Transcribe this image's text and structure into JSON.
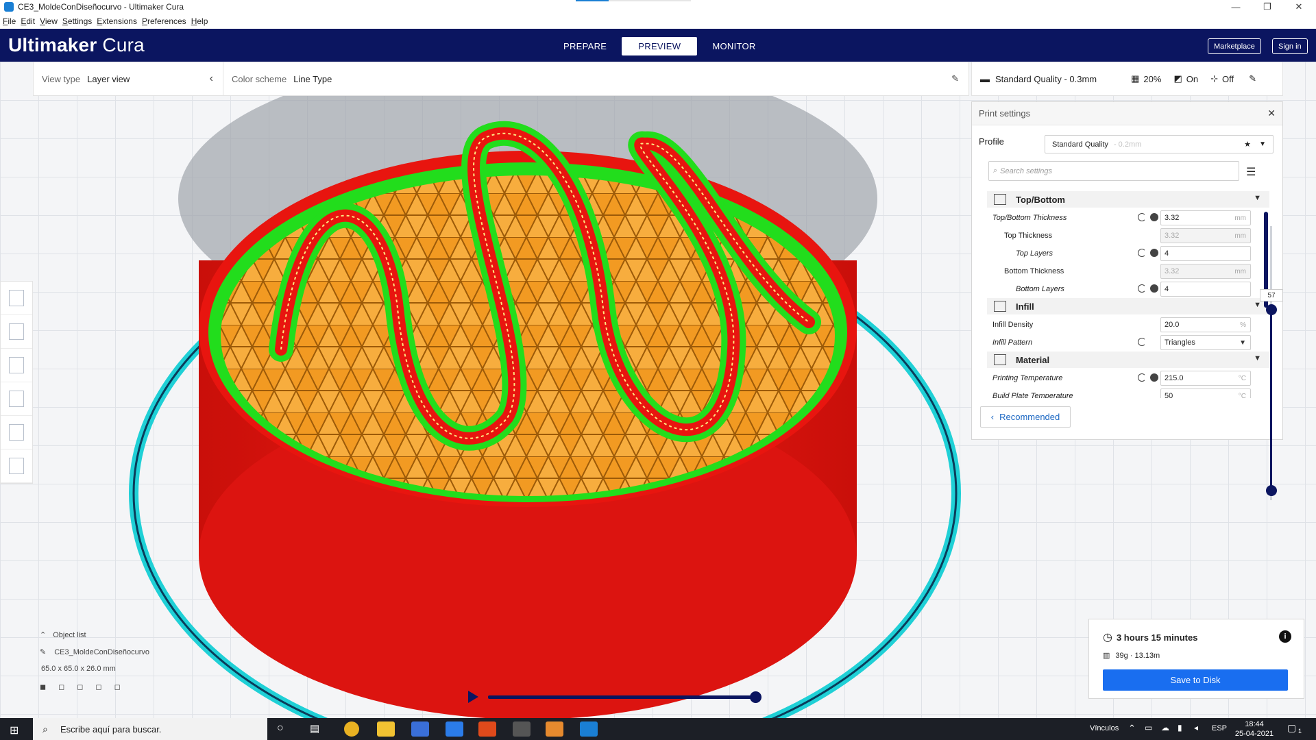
{
  "window": {
    "title": "CE3_MoldeConDiseñocurvo - Ultimaker Cura",
    "minimize": "—",
    "maximize": "❐",
    "close": "✕"
  },
  "menu": [
    "File",
    "Edit",
    "View",
    "Settings",
    "Extensions",
    "Preferences",
    "Help"
  ],
  "header": {
    "logo_bold": "Ultimaker",
    "logo_light": " Cura",
    "stages": [
      "PREPARE",
      "PREVIEW",
      "MONITOR"
    ],
    "active_stage": "PREVIEW",
    "marketplace": "Marketplace",
    "signin": "Sign in"
  },
  "viewbar": {
    "view_type_label": "View type",
    "view_type_value": "Layer view",
    "color_scheme_label": "Color scheme",
    "color_scheme_value": "Line Type"
  },
  "printbar": {
    "profile": "Standard Quality - 0.3mm",
    "infill": "20%",
    "support": "On",
    "adhesion": "Off"
  },
  "print_settings": {
    "title": "Print settings",
    "profile_label": "Profile",
    "profile_value": "Standard Quality",
    "profile_dim": "- 0.2mm",
    "search_placeholder": "Search settings",
    "categories": [
      {
        "name": "Top/Bottom",
        "settings": [
          {
            "name": "Top/Bottom Thickness",
            "value": "3.32",
            "unit": "mm",
            "italic": true,
            "indent": 0,
            "disabled": false
          },
          {
            "name": "Top Thickness",
            "value": "3.32",
            "unit": "mm",
            "italic": false,
            "indent": 1,
            "disabled": true
          },
          {
            "name": "Top Layers",
            "value": "4",
            "unit": "",
            "italic": true,
            "indent": 2,
            "disabled": false
          },
          {
            "name": "Bottom Thickness",
            "value": "3.32",
            "unit": "mm",
            "italic": false,
            "indent": 1,
            "disabled": true
          },
          {
            "name": "Bottom Layers",
            "value": "4",
            "unit": "",
            "italic": true,
            "indent": 2,
            "disabled": false
          }
        ]
      },
      {
        "name": "Infill",
        "settings": [
          {
            "name": "Infill Density",
            "value": "20.0",
            "unit": "%",
            "italic": false,
            "indent": 0,
            "disabled": false
          },
          {
            "name": "Infill Pattern",
            "value": "Triangles",
            "unit": "",
            "italic": true,
            "indent": 0,
            "disabled": false
          }
        ]
      },
      {
        "name": "Material",
        "settings": [
          {
            "name": "Printing Temperature",
            "value": "215.0",
            "unit": "°C",
            "italic": true,
            "indent": 0,
            "disabled": false
          },
          {
            "name": "Build Plate Temperature",
            "value": "50",
            "unit": "°C",
            "italic": true,
            "indent": 0,
            "disabled": false
          }
        ]
      }
    ],
    "recommended": "Recommended"
  },
  "layer_slider": {
    "current_layer": "57",
    "min_layer": 1,
    "max_layer": 57
  },
  "object_list": {
    "label": "Object list",
    "object_name": "CE3_MoldeConDiseñocurvo",
    "dimensions": "65.0 x 65.0 x 26.0 mm"
  },
  "playback": {
    "progress": 1.0
  },
  "job": {
    "time": "3 hours 15 minutes",
    "material": "39g · 13.13m",
    "save": "Save to Disk"
  },
  "taskbar": {
    "search_placeholder": "Escribe aquí para buscar.",
    "links": "Vínculos",
    "lang": "ESP",
    "time": "18:44",
    "date": "25-04-2021",
    "notif": "1"
  },
  "colors": {
    "brand": "#0b1560",
    "accent": "#196ef0",
    "wall_outer": "#e8150f",
    "wall_inner": "#22dd1c",
    "infill": "#f29a22",
    "skirt": "#1fd0d6"
  }
}
